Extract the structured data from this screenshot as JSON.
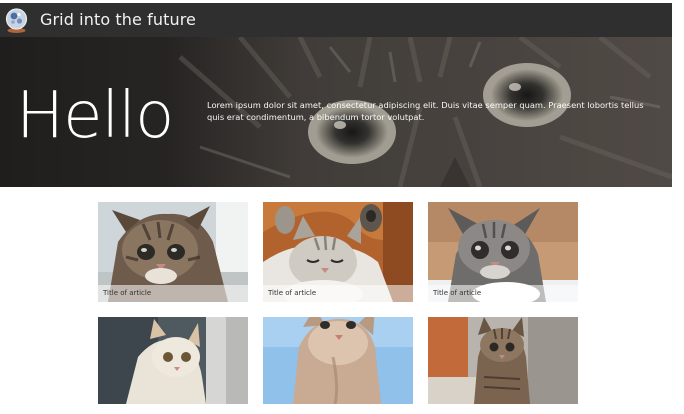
{
  "header": {
    "site_title": "Grid into the future",
    "logo_icon": "globe-logo-icon",
    "background": "#2f2f30"
  },
  "hero": {
    "heading": "Hello",
    "body": "Lorem ipsum dolor sit amet, consectetur adipiscing elit. Duis vitae semper quam. Praesent lobortis tellus quis erat condimentum, a bibendum tortor volutpat.",
    "image": "cat-closeup-image"
  },
  "articles": [
    {
      "caption": "Title of article",
      "image": "kitten-tabby-image"
    },
    {
      "caption": "Title of article",
      "image": "kitten-sleeping-image"
    },
    {
      "caption": "Title of article",
      "image": "kitten-grey-image"
    },
    {
      "caption": "",
      "image": "kitten-white-image"
    },
    {
      "caption": "",
      "image": "kitten-sky-image"
    },
    {
      "caption": "",
      "image": "kitten-doorway-image"
    }
  ]
}
